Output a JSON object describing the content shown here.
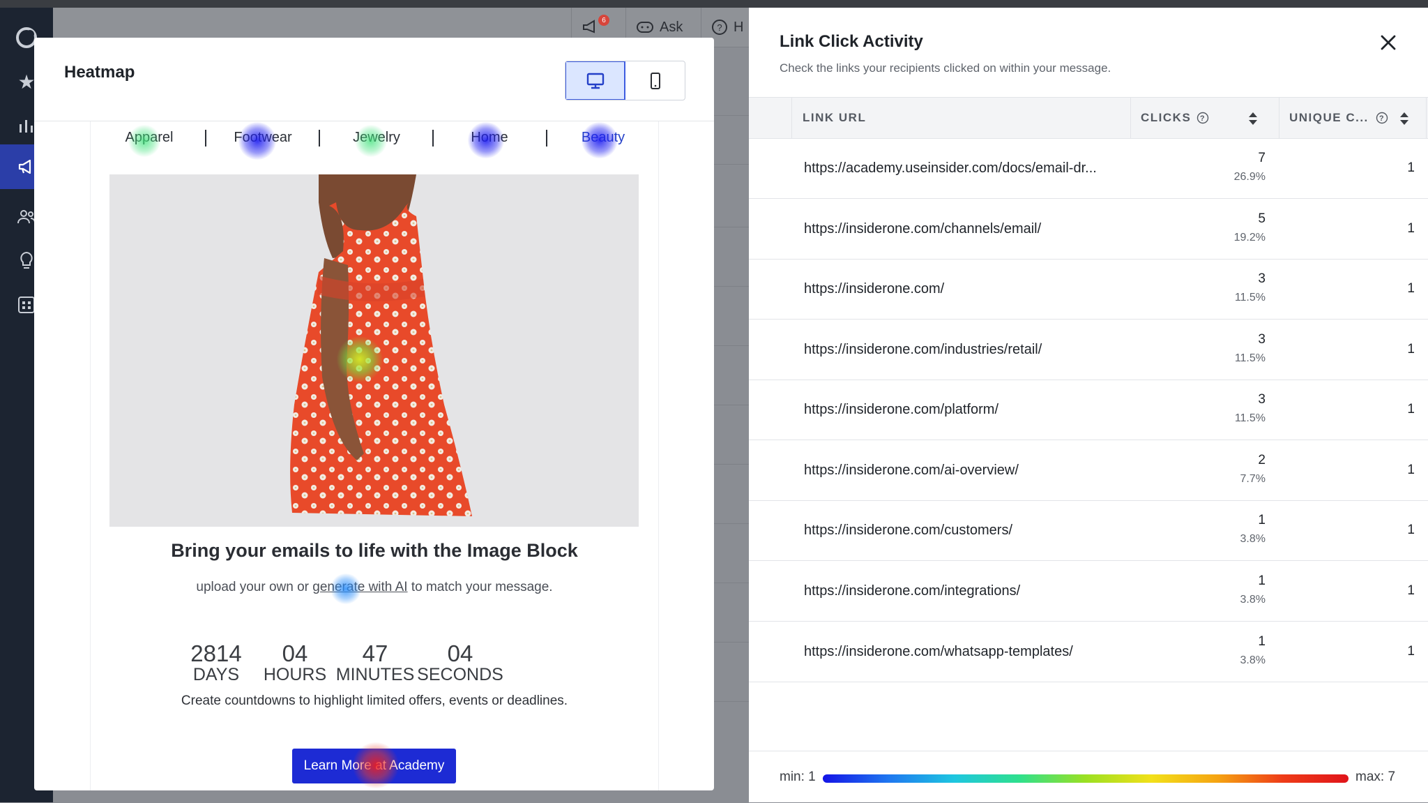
{
  "app": {
    "sidebar": [
      "logo-icon",
      "star-icon",
      "chart-icon",
      "megaphone-icon",
      "users-icon",
      "bulb-icon",
      "grid-icon"
    ],
    "topbar": {
      "notification_count": "6",
      "ask_label": "Ask",
      "help_label": "H"
    }
  },
  "heatmap": {
    "title": "Heatmap",
    "view_toggle": [
      "desktop-icon",
      "mobile-icon"
    ],
    "selected_view": "desktop",
    "email": {
      "nav": [
        "Apparel",
        "Footwear",
        "Jewelry",
        "Home",
        "Beauty"
      ],
      "headline": "Bring your emails to life with the Image Block",
      "sub_before": "upload your own or ",
      "sub_link": "generate with AI",
      "sub_after": " to match your message.",
      "countdown": [
        {
          "value": "2814",
          "label": "DAYS"
        },
        {
          "value": "04",
          "label": "HOURS"
        },
        {
          "value": "47",
          "label": "MINUTES"
        },
        {
          "value": "04",
          "label": "SECONDS"
        }
      ],
      "countdown_caption": "Create countdowns to highlight limited offers, events or deadlines.",
      "cta": "Learn More at Academy"
    }
  },
  "drawer": {
    "title": "Link Click Activity",
    "subtitle": "Check the links your recipients clicked on within your message.",
    "columns": {
      "url": "LINK URL",
      "clicks": "CLICKS",
      "unique": "UNIQUE C..."
    },
    "rows": [
      {
        "url": "https://academy.useinsider.com/docs/email-dr...",
        "clicks": "7",
        "pct": "26.9%",
        "unique": "1"
      },
      {
        "url": "https://insiderone.com/channels/email/",
        "clicks": "5",
        "pct": "19.2%",
        "unique": "1"
      },
      {
        "url": "https://insiderone.com/",
        "clicks": "3",
        "pct": "11.5%",
        "unique": "1"
      },
      {
        "url": "https://insiderone.com/industries/retail/",
        "clicks": "3",
        "pct": "11.5%",
        "unique": "1"
      },
      {
        "url": "https://insiderone.com/platform/",
        "clicks": "3",
        "pct": "11.5%",
        "unique": "1"
      },
      {
        "url": "https://insiderone.com/ai-overview/",
        "clicks": "2",
        "pct": "7.7%",
        "unique": "1"
      },
      {
        "url": "https://insiderone.com/customers/",
        "clicks": "1",
        "pct": "3.8%",
        "unique": "1"
      },
      {
        "url": "https://insiderone.com/integrations/",
        "clicks": "1",
        "pct": "3.8%",
        "unique": "1"
      },
      {
        "url": "https://insiderone.com/whatsapp-templates/",
        "clicks": "1",
        "pct": "3.8%",
        "unique": "1"
      }
    ],
    "legend": {
      "min": "min: 1",
      "max": "max: 7"
    }
  },
  "colors": {
    "accent": "#1d2bd4",
    "sidebar_active": "#2b3ea8",
    "sidebar_bg": "#1c2431"
  }
}
